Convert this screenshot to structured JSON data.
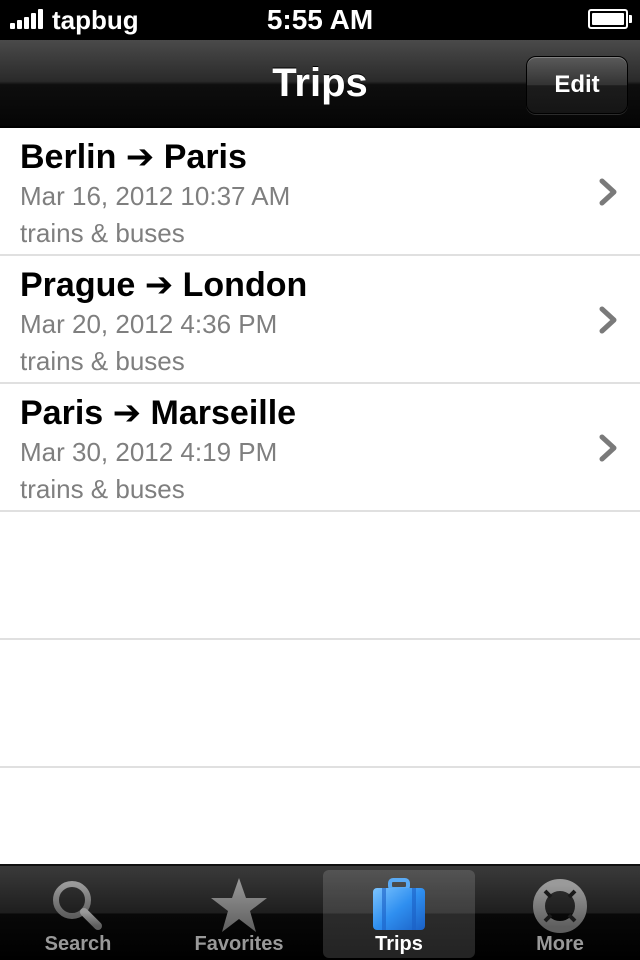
{
  "status_bar": {
    "carrier": "tapbug",
    "time": "5:55 AM"
  },
  "nav_bar": {
    "title": "Trips",
    "edit_label": "Edit"
  },
  "trips": [
    {
      "route": "Berlin ➔ Paris",
      "date": "Mar 16, 2012 10:37 AM",
      "mode": "trains & buses"
    },
    {
      "route": "Prague ➔ London",
      "date": "Mar 20, 2012 4:36 PM",
      "mode": "trains & buses"
    },
    {
      "route": "Paris ➔ Marseille",
      "date": "Mar 30, 2012 4:19 PM",
      "mode": "trains & buses"
    }
  ],
  "tab_bar": {
    "selected": "Trips",
    "tabs": [
      {
        "label": "Search",
        "icon": "magnifier-icon"
      },
      {
        "label": "Favorites",
        "icon": "star-icon"
      },
      {
        "label": "Trips",
        "icon": "briefcase-icon"
      },
      {
        "label": "More",
        "icon": "lifebuoy-icon"
      }
    ]
  },
  "colors": {
    "accent_blue": "#2f8ff0",
    "secondary_text": "#7f7f7f"
  }
}
